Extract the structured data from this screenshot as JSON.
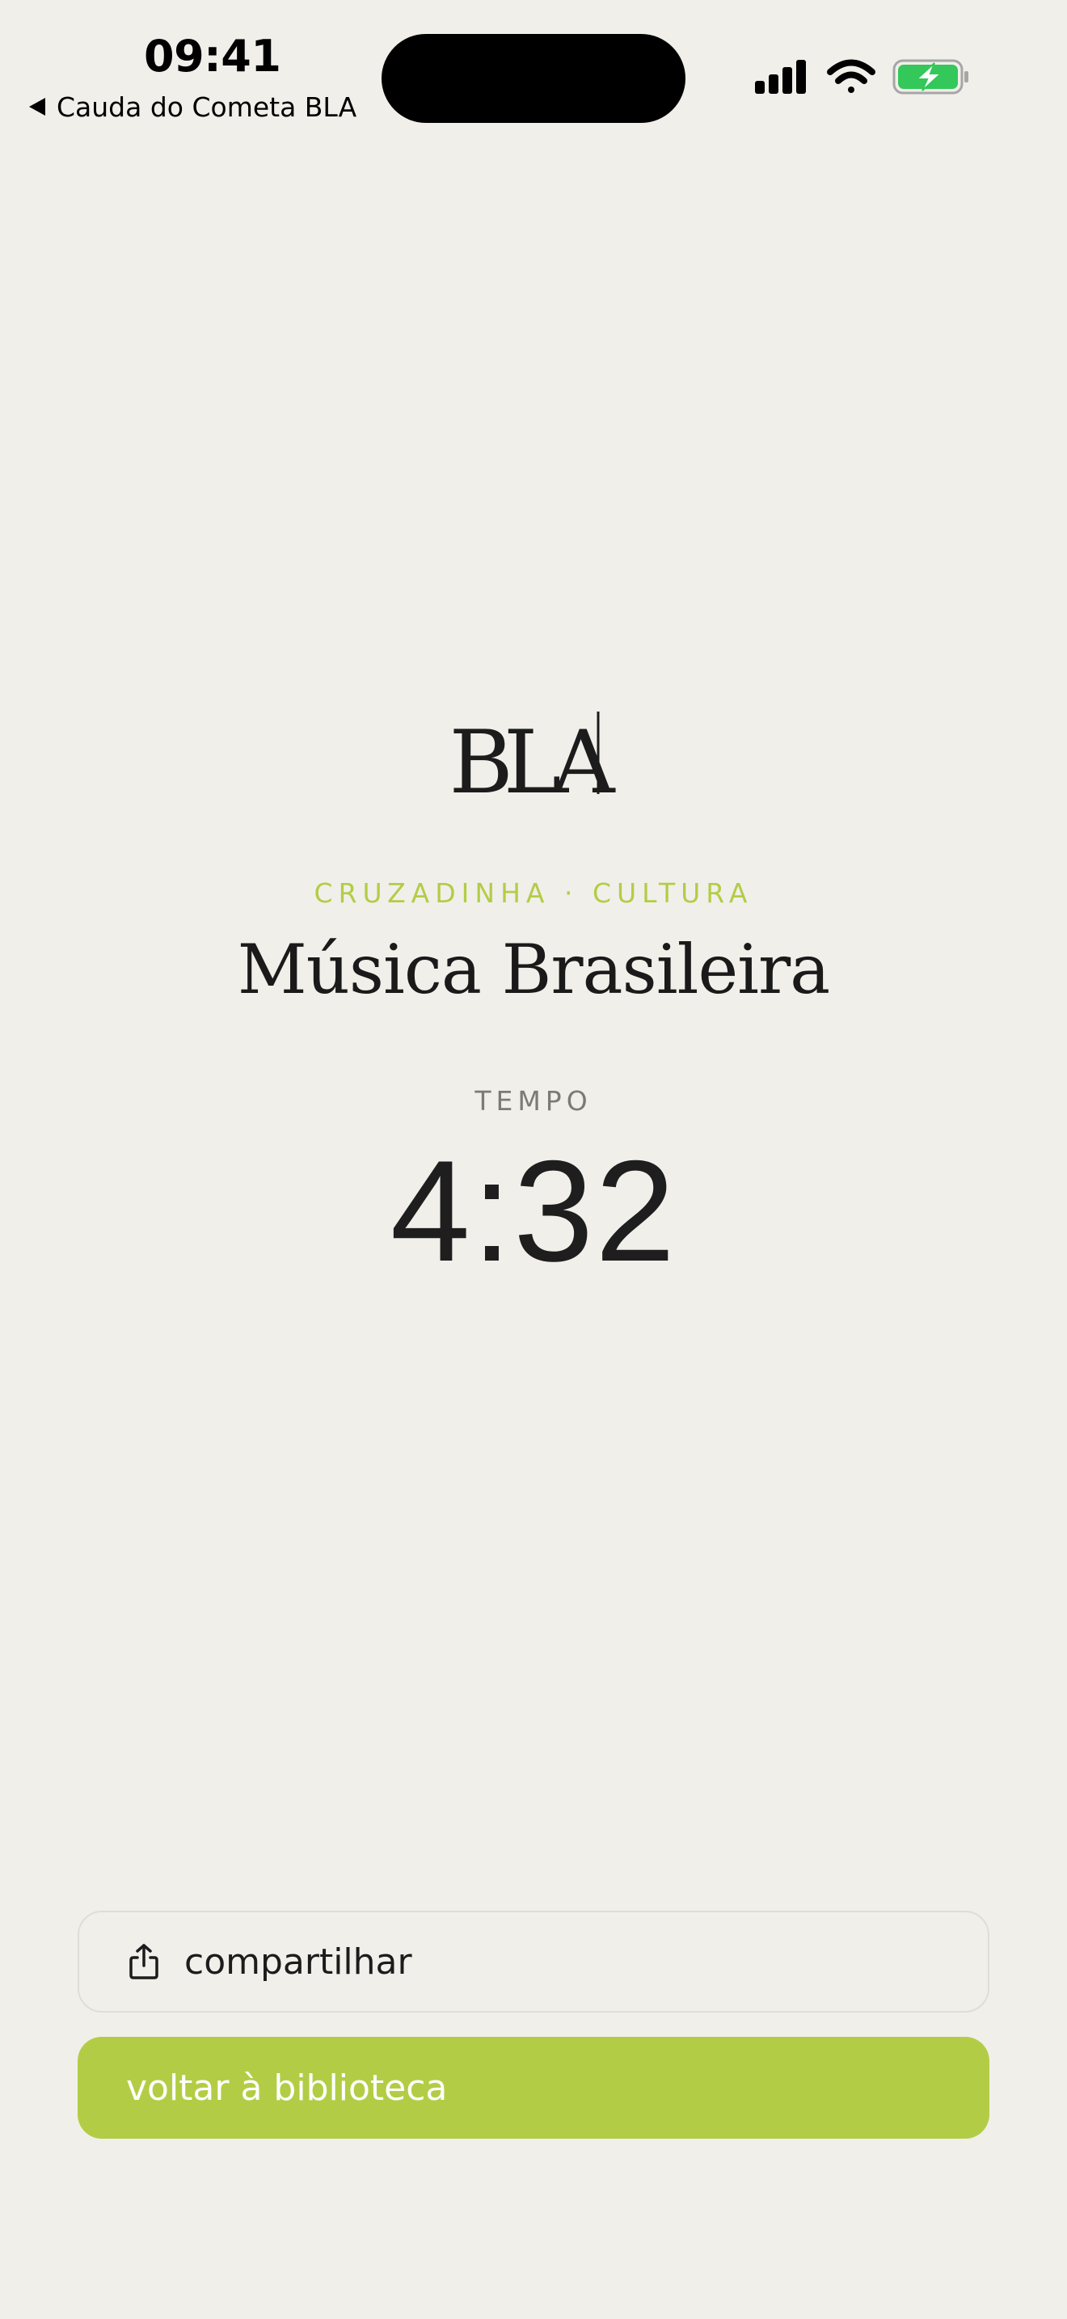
{
  "status_bar": {
    "time": "09:41",
    "back_app": "Cauda do Cometa BLA",
    "icons": [
      "signal-icon",
      "wifi-icon",
      "battery-charging-icon"
    ],
    "battery_color": "#34c759"
  },
  "brand": {
    "logo_text": "BLA"
  },
  "puzzle": {
    "category": "CRUZADINHA · CULTURA",
    "title": "Música Brasileira"
  },
  "result": {
    "time_label": "TEMPO",
    "time_value": "4:32"
  },
  "actions": {
    "share_label": "compartilhar",
    "share_icon": "share-icon",
    "library_label": "voltar à biblioteca"
  },
  "colors": {
    "background": "#f1efea",
    "accent": "#b2cd45",
    "text": "#1c1c1c",
    "muted": "#7d7a74"
  }
}
